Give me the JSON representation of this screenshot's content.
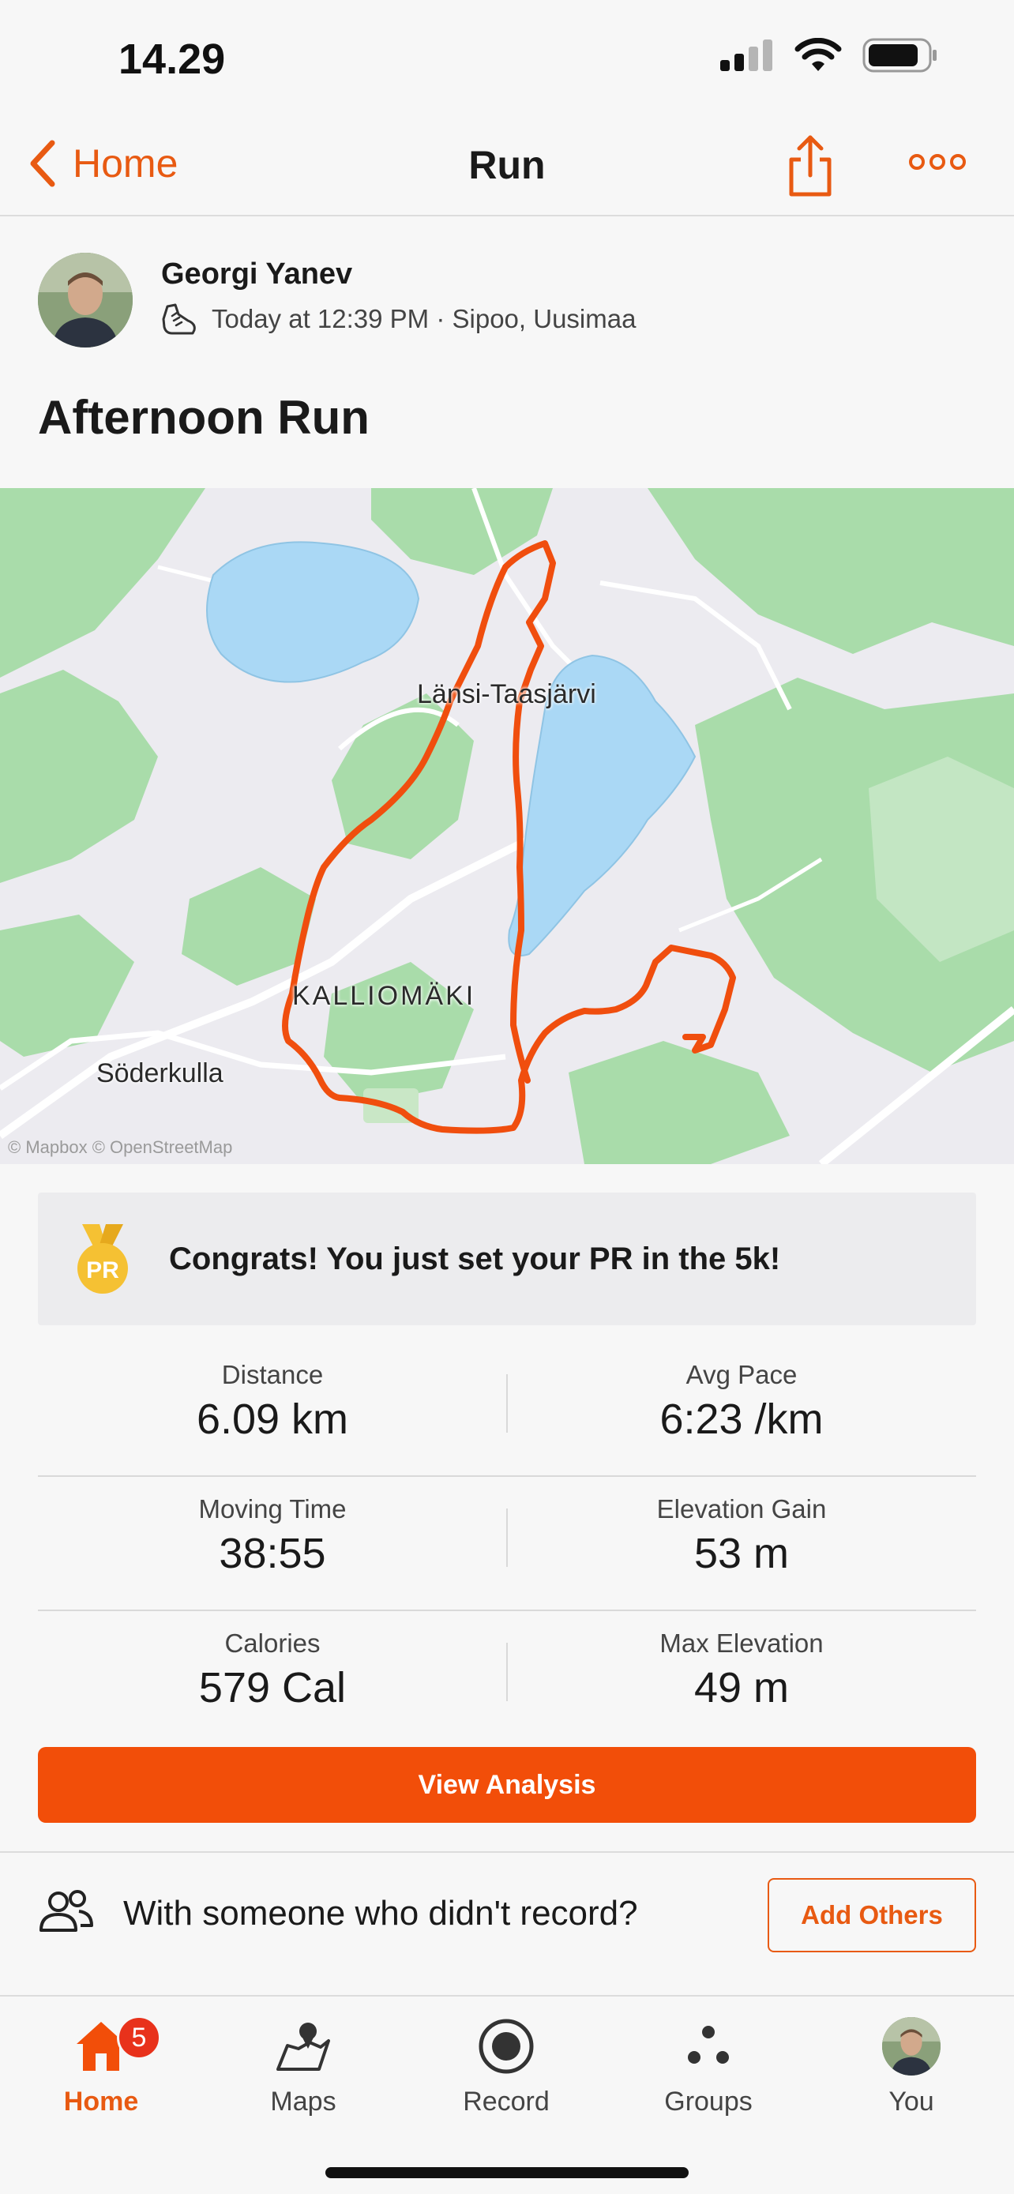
{
  "status_bar": {
    "time": "14.29"
  },
  "nav": {
    "back_label": "Home",
    "title": "Run"
  },
  "athlete": {
    "name": "Georgi Yanev",
    "meta": "Today at 12:39 PM · Sipoo, Uusimaa"
  },
  "activity": {
    "title": "Afternoon Run"
  },
  "map": {
    "labels": {
      "lake": "Länsi-Taasjärvi",
      "district": "KALLIOMÄKI",
      "town": "Söderkulla"
    },
    "attribution": "© Mapbox © OpenStreetMap"
  },
  "pr_banner": {
    "medal_text": "PR",
    "text": "Congrats! You just set your PR in the 5k!"
  },
  "stats": [
    {
      "left": {
        "label": "Distance",
        "value": "6.09 km"
      },
      "right": {
        "label": "Avg Pace",
        "value": "6:23 /km"
      }
    },
    {
      "left": {
        "label": "Moving Time",
        "value": "38:55"
      },
      "right": {
        "label": "Elevation Gain",
        "value": "53 m"
      }
    },
    {
      "left": {
        "label": "Calories",
        "value": "579 Cal"
      },
      "right": {
        "label": "Max Elevation",
        "value": "49 m"
      }
    }
  ],
  "analysis_button": "View Analysis",
  "others": {
    "text": "With someone who didn't record?",
    "button": "Add Others"
  },
  "tabs": [
    {
      "label": "Home",
      "badge": "5",
      "icon": "home-icon"
    },
    {
      "label": "Maps",
      "icon": "maps-icon"
    },
    {
      "label": "Record",
      "icon": "record-icon"
    },
    {
      "label": "Groups",
      "icon": "groups-icon"
    },
    {
      "label": "You",
      "icon": "avatar"
    }
  ],
  "colors": {
    "accent": "#f24e09",
    "route": "#f04e0e",
    "water": "#aad8f5",
    "park": "#a9dcaa"
  }
}
